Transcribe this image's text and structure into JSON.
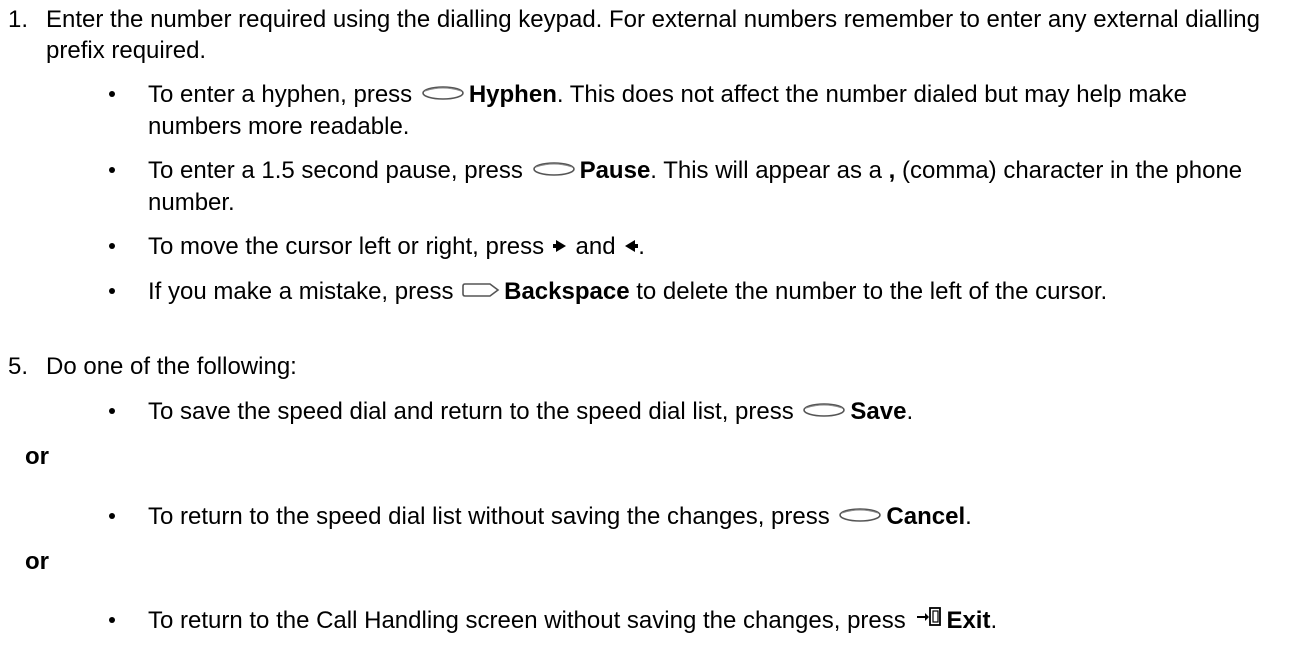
{
  "step1": {
    "number": "1.",
    "text": "Enter the number required using the dialling keypad. For external numbers remember to enter any external dialling prefix required."
  },
  "step1_bullets": {
    "hyphen": {
      "pre": "To enter a hyphen, press",
      "key_icon": "oval-softkey-icon",
      "key": "Hyphen",
      "post": ". This does not affect the number dialed but may help make numbers more readable."
    },
    "pause": {
      "pre": "To enter a 1.5 second pause, press",
      "key_icon": "oval-softkey-icon",
      "key": "Pause",
      "mid": ". This will appear as a",
      "comma": ",",
      "post": "(comma) character in the phone number."
    },
    "cursor": {
      "pre": "To move the cursor left or right, press",
      "right_icon": "arrow-right-icon",
      "and": "and",
      "left_icon": "arrow-left-icon",
      "post": "."
    },
    "backspace": {
      "pre": "If you make a mistake, press",
      "key_icon": "backspace-key-icon",
      "key": "Backspace",
      "post": "to delete the number to the left of the cursor."
    }
  },
  "step5": {
    "number": "5.",
    "text": "Do one of the following:"
  },
  "step5_options": {
    "save": {
      "pre": "To save the speed dial and return to the speed dial list, press",
      "key_icon": "oval-softkey-icon",
      "key": "Save",
      "post": "."
    },
    "or1": "or",
    "cancel": {
      "pre": "To return to the speed dial list without saving the changes, press",
      "key_icon": "oval-softkey-icon",
      "key": "Cancel",
      "post": "."
    },
    "or2": "or",
    "exit": {
      "pre": "To return to the Call Handling screen without saving the changes, press",
      "key_icon": "exit-door-icon",
      "key": "Exit",
      "post": "."
    }
  }
}
